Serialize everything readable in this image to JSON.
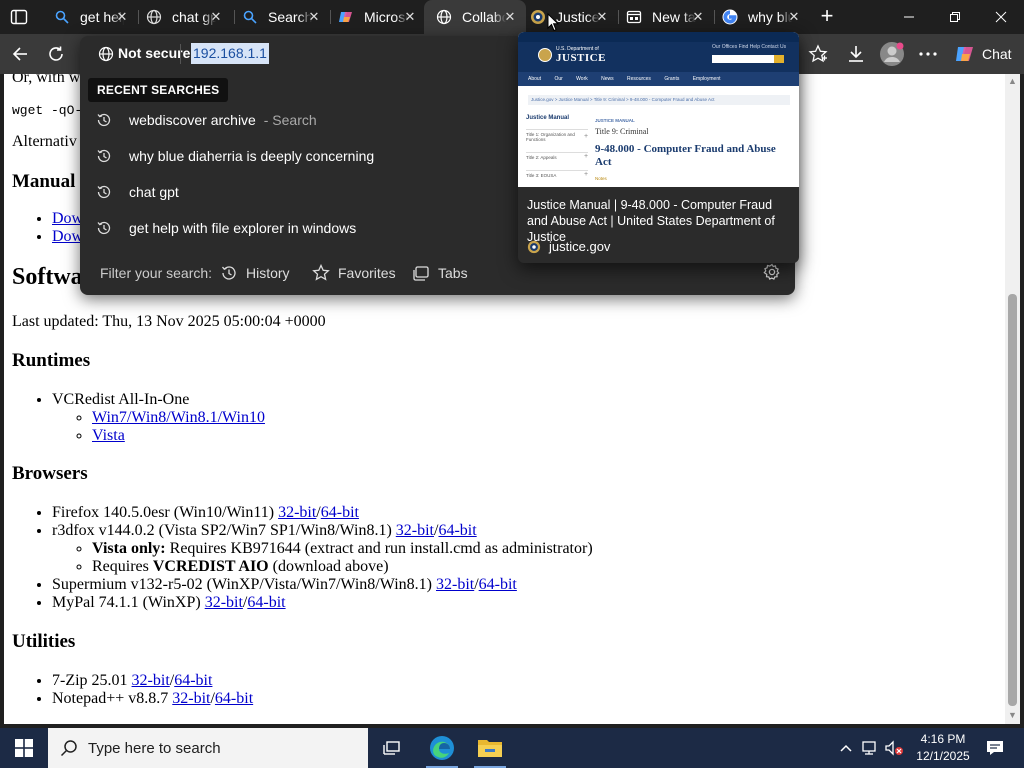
{
  "colors": {
    "titlebar": "#1f1f1f",
    "toolbar": "#3a3a3a",
    "dropdown": "#2b2b2b",
    "link": "#0000cc",
    "taskbar": "#1c2a45",
    "url_highlight": "#d7e4f7"
  },
  "tabs": [
    {
      "label": "get help with file explorer",
      "icon": "bing-search-icon"
    },
    {
      "label": "chat gpt",
      "icon": "globe-icon"
    },
    {
      "label": "Search",
      "icon": "bing-search-icon"
    },
    {
      "label": "Microsoft",
      "icon": "copilot-icon"
    },
    {
      "label": "Collaborate",
      "icon": "globe-icon",
      "active": true
    },
    {
      "label": "Justice Manual",
      "icon": "doj-seal-icon"
    },
    {
      "label": "New tab",
      "icon": "newtab-icon"
    },
    {
      "label": "why blue",
      "icon": "google-icon"
    }
  ],
  "toolbar": {
    "chat_label": "Chat"
  },
  "address": {
    "security_label": "Not secure",
    "url": "192.168.1.1",
    "recent_heading": "RECENT SEARCHES",
    "suggestions": [
      {
        "text": "webdiscover archive",
        "extra": " - Search",
        "icon": "history-icon"
      },
      {
        "text": "why blue diaherria is deeply concerning",
        "extra": "",
        "icon": "history-icon"
      },
      {
        "text": "chat gpt",
        "extra": "",
        "icon": "history-icon"
      },
      {
        "text": "get help with file explorer in windows",
        "extra": "",
        "icon": "history-icon"
      }
    ],
    "filter_label": "Filter your search:",
    "filters": {
      "history": "History",
      "favorites": "Favorites",
      "tabs": "Tabs"
    }
  },
  "preview": {
    "thumb": {
      "dept_small": "U.S. Department of",
      "dept_big": "JUSTICE",
      "links": "Our Offices   Find Help   Contact Us",
      "nav": "About Our Work News Resources Grants Employment",
      "crumb": "Justice.gov  >  Justice Manual  >  Title 9: Criminal  >  9-48.000 - Computer Fraud and Abuse Act",
      "side_heading": "Justice Manual",
      "side_items": [
        "Title 1: Organization and Functions",
        "Title 2: Appeals",
        "Title 3: EOUSA"
      ],
      "jm_label": "JUSTICE MANUAL",
      "t9": "Title 9: Criminal",
      "title": "9-48.000 - Computer Fraud and Abuse Act",
      "next": "Notes"
    },
    "title": "Justice Manual | 9-48.000 - Computer Fraud and Abuse Act | United States Department of Justice",
    "site": "justice.gov"
  },
  "page": {
    "partial_top": "Or, with w",
    "wget": "wget -qO-",
    "alternative": "Alternativ",
    "manual_heading": "Manual I",
    "download_links": [
      "Dow",
      "Dow"
    ],
    "software_heading": "Softwa",
    "updated": "Last updated: Thu, 13 Nov 2025 05:00:04 +0000",
    "runtimes": {
      "heading": "Runtimes",
      "item": "VCRedist All-In-One",
      "links": [
        "Win7/Win8/Win8.1/Win10",
        "Vista"
      ]
    },
    "browsers": {
      "heading": "Browsers",
      "firefox": {
        "text": "Firefox 140.5.0esr (Win10/Win11) ",
        "a32": "32-bit",
        "a64": "64-bit"
      },
      "r3dfox": {
        "text": "r3dfox v144.0.2 (Vista SP2/Win7 SP1/Win8/Win8.1) ",
        "a32": "32-bit",
        "a64": "64-bit"
      },
      "vista_only_bold": "Vista only:",
      "vista_only_rest": " Requires KB971644 (extract and run install.cmd as administrator)",
      "requires_pre": "Requires ",
      "requires_bold": "VCREDIST AIO",
      "requires_post": " (download above)",
      "supermium": {
        "text": "Supermium v132-r5-02 (WinXP/Vista/Win7/Win8/Win8.1) ",
        "a32": "32-bit",
        "a64": "64-bit"
      },
      "mypal": {
        "text": "MyPal 74.1.1 (WinXP) ",
        "a32": "32-bit",
        "a64": "64-bit"
      }
    },
    "utilities": {
      "heading": "Utilities",
      "sevenzip": {
        "text": "7-Zip 25.01 ",
        "a32": "32-bit",
        "a64": "64-bit"
      },
      "notepad": {
        "text": "Notepad++ v8.8.7 ",
        "a32": "32-bit",
        "a64": "64-bit"
      }
    },
    "slash": "/"
  },
  "taskbar": {
    "search_placeholder": "Type here to search",
    "time": "4:16 PM",
    "date": "12/1/2025"
  }
}
